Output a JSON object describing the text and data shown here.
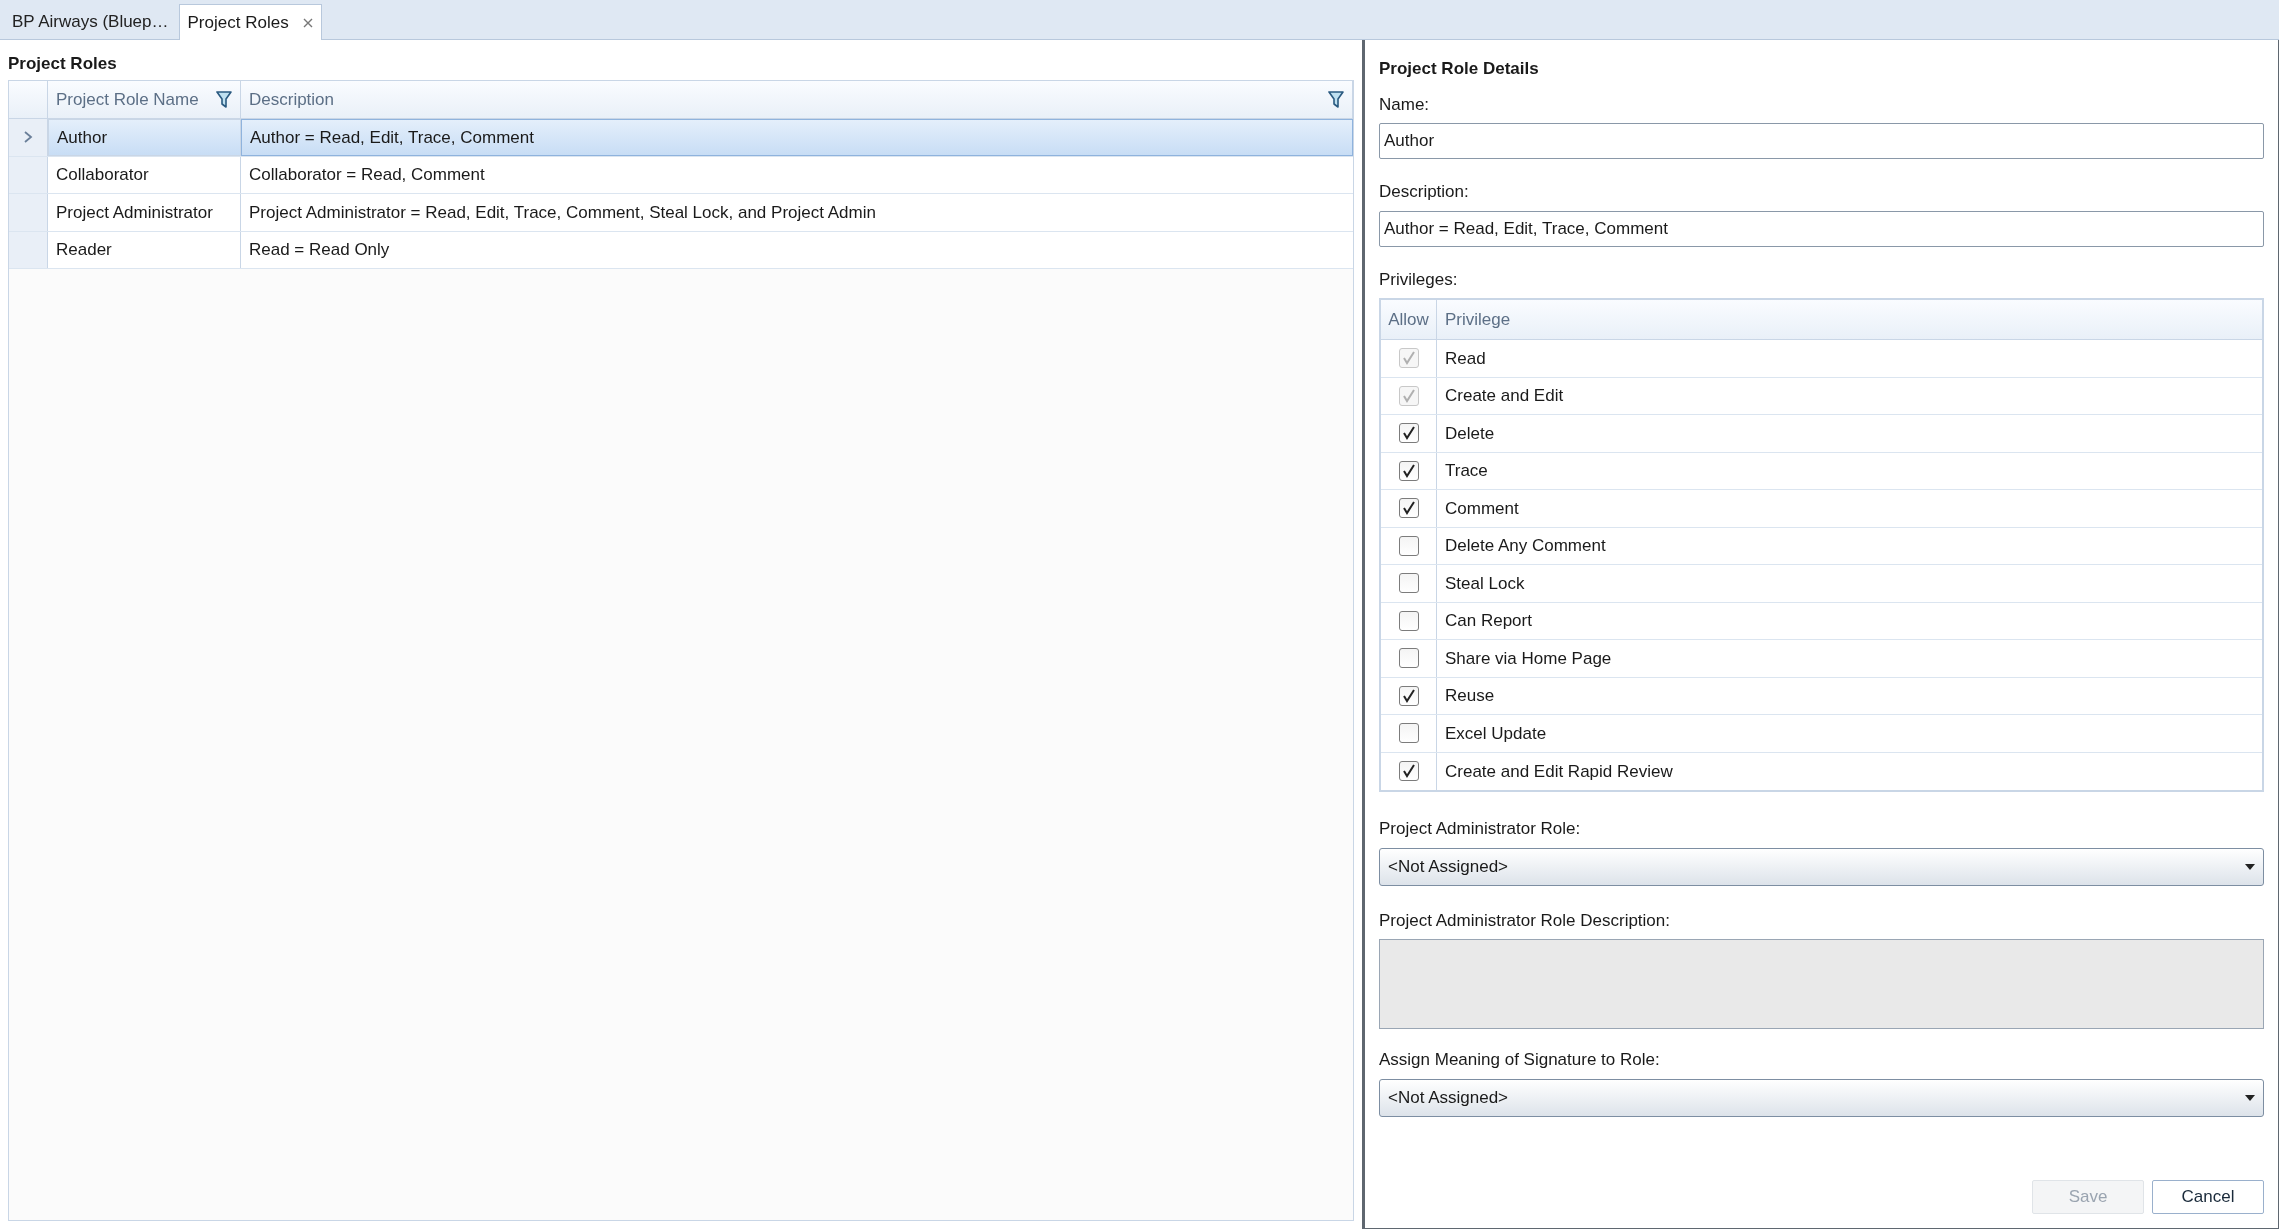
{
  "tabs": [
    {
      "label": "BP Airways (Bluep…",
      "selected": false,
      "closable": false
    },
    {
      "label": "Project Roles",
      "selected": true,
      "closable": true
    }
  ],
  "roles_panel": {
    "title": "Project Roles",
    "columns": [
      {
        "label": "Project Role Name",
        "filter": true
      },
      {
        "label": "Description",
        "filter": true
      }
    ],
    "rows": [
      {
        "name": "Author",
        "description": "Author = Read, Edit, Trace, Comment",
        "selected": true
      },
      {
        "name": "Collaborator",
        "description": "Collaborator = Read, Comment",
        "selected": false
      },
      {
        "name": "Project Administrator",
        "description": "Project Administrator = Read, Edit, Trace, Comment, Steal Lock, and Project Admin",
        "selected": false
      },
      {
        "name": "Reader",
        "description": "Read = Read Only",
        "selected": false
      }
    ]
  },
  "details": {
    "title": "Project Role Details",
    "name_label": "Name:",
    "name_value": "Author",
    "description_label": "Description:",
    "description_value": "Author = Read, Edit, Trace, Comment",
    "privileges_label": "Privileges:",
    "privilege_columns": [
      "Allow",
      "Privilege"
    ],
    "privileges": [
      {
        "label": "Read",
        "checked": true,
        "disabled": true
      },
      {
        "label": "Create and Edit",
        "checked": true,
        "disabled": true
      },
      {
        "label": "Delete",
        "checked": true,
        "disabled": false
      },
      {
        "label": "Trace",
        "checked": true,
        "disabled": false
      },
      {
        "label": "Comment",
        "checked": true,
        "disabled": false
      },
      {
        "label": "Delete Any Comment",
        "checked": false,
        "disabled": false
      },
      {
        "label": "Steal Lock",
        "checked": false,
        "disabled": false
      },
      {
        "label": "Can Report",
        "checked": false,
        "disabled": false
      },
      {
        "label": "Share via Home Page",
        "checked": false,
        "disabled": false
      },
      {
        "label": "Reuse",
        "checked": true,
        "disabled": false
      },
      {
        "label": "Excel Update",
        "checked": false,
        "disabled": false
      },
      {
        "label": "Create and Edit Rapid Review",
        "checked": true,
        "disabled": false
      }
    ],
    "admin_role_label": "Project Administrator Role:",
    "admin_role_value": "<Not Assigned>",
    "admin_role_description_label": "Project Administrator Role Description:",
    "signature_label": "Assign Meaning of Signature to Role:",
    "signature_value": "<Not Assigned>",
    "buttons": [
      {
        "label": "Save",
        "disabled": true
      },
      {
        "label": "Cancel",
        "disabled": false
      }
    ]
  }
}
